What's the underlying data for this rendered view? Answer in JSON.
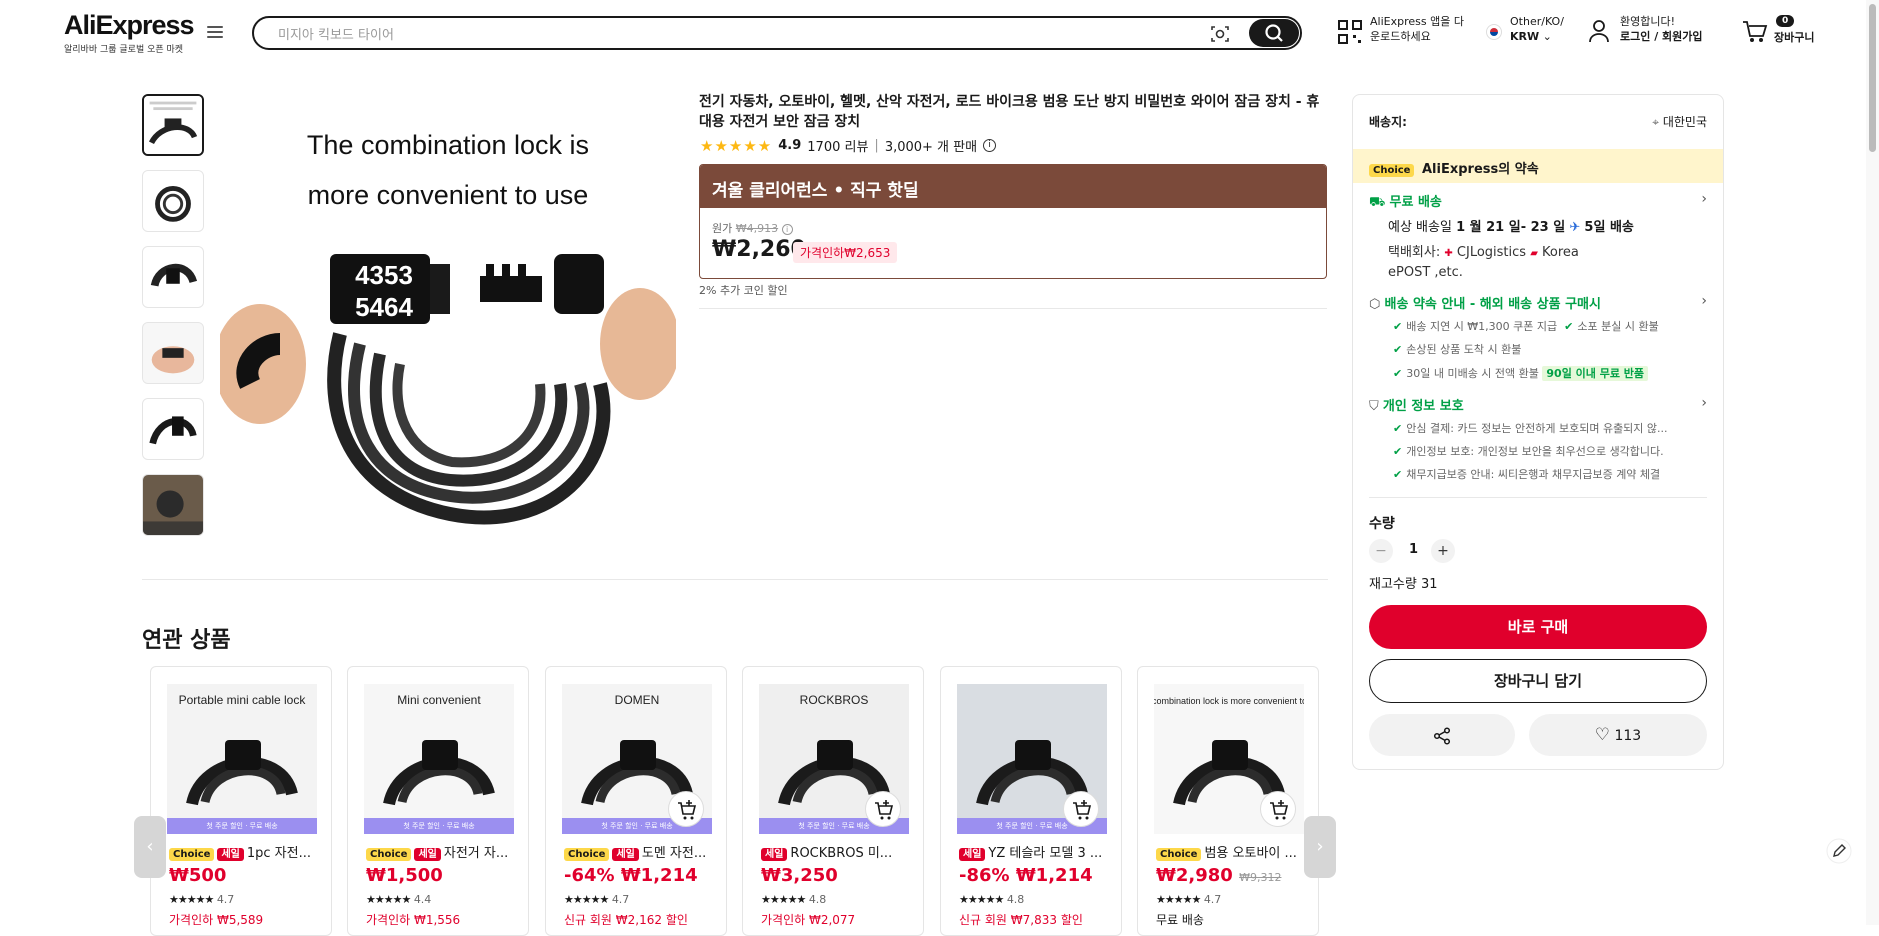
{
  "header": {
    "brand": "AliExpress",
    "brand_sub": "알리바바 그룹 글로벌 오픈 마켓",
    "search_placeholder": "미지아 킥보드 타이어",
    "app_line1": "AliExpress 앱을 다",
    "app_line2": "운로드하세요",
    "locale_line1": "Other/KO/",
    "locale_line2": "KRW",
    "account_line1": "환영합니다!",
    "account_line2": "로그인 / 회원가입",
    "cart_count": "0",
    "cart_label": "장바구니"
  },
  "gallery": {
    "caption_line1": "The combination lock is",
    "caption_line2": "more convenient to use",
    "code_top": "4353",
    "code_bottom": "5464"
  },
  "product": {
    "title": "전기 자동차, 오토바이, 헬멧, 산악 자전거, 로드 바이크용 범용 도난 방지 비밀번호 와이어 잠금 장치 - 휴대용 자전거 보안 잠금 장치",
    "rating": "4.9",
    "reviews": "1700 리뷰",
    "sold": "3,000+ 개 판매",
    "promo_banner": "겨울 클리어런스 • 직구 핫딜",
    "orig_label": "원가",
    "orig_price": "₩4,913",
    "price": "₩2,260",
    "discount": "가격인하₩2,653",
    "coin": "2% 추가 코인 할인"
  },
  "related": {
    "title": "연관 상품",
    "items": [
      {
        "img_text": "Portable mini cable lock",
        "tags": [
          "Choice",
          "세일"
        ],
        "name": "1pc 자전...",
        "price": "₩500",
        "old": "",
        "rating": "4.7",
        "extra": "가격인하 ₩5,589",
        "strip": "첫 주문 할인 · 무료 배송"
      },
      {
        "img_text": "Mini convenient",
        "tags": [
          "Choice",
          "세일"
        ],
        "name": "자전거 자...",
        "price": "₩1,500",
        "old": "",
        "rating": "4.4",
        "extra": "가격인하 ₩1,556",
        "strip": "첫 주문 할인 · 무료 배송"
      },
      {
        "img_text": "DOMEN",
        "tags": [
          "Choice",
          "세일"
        ],
        "name": "도멘 자전...",
        "price": "-64% ₩1,214",
        "old": "",
        "rating": "4.7",
        "extra": "신규 회원 ₩2,162 할인",
        "strip": "첫 주문 할인 · 무료 배송"
      },
      {
        "img_text": "ROCKBROS",
        "tags": [
          "세일"
        ],
        "name": "ROCKBROS 미...",
        "price": "₩3,250",
        "old": "",
        "rating": "4.8",
        "extra": "가격인하 ₩2,077",
        "strip": "첫 주문 할인 · 무료 배송"
      },
      {
        "img_text": "",
        "tags": [
          "세일"
        ],
        "name": "YZ 테슬라 모델 3 ...",
        "price": "-86% ₩1,214",
        "old": "",
        "rating": "4.8",
        "extra": "신규 회원 ₩7,833 할인",
        "strip": "첫 주문 할인 · 무료 배송"
      },
      {
        "img_text": "The combination lock is more convenient to use",
        "tags": [
          "Choice"
        ],
        "name": "범용 오토바이 ...",
        "price": "₩2,980",
        "old": "₩9,312",
        "rating": "4.7",
        "extra": "무료 배송",
        "strip": ""
      }
    ]
  },
  "side": {
    "ship_to": "배송지:",
    "country": "대한민국",
    "choice": "Choice",
    "promise": "AliExpress의 약속",
    "free_ship": "무료 배송",
    "eta_prefix": "예상 배송일",
    "eta_dates": "1 월 21 일- 23 일",
    "eta_days": "5일 배송",
    "carrier_label": "택배회사:",
    "carrier1": "CJLogistics",
    "carrier2": "Korea",
    "carrier3": "ePOST ,etc.",
    "promise_title": "배송 약속 안내 - 해외 배송 상품 구매시",
    "p1": "배송 지연 시 ₩1,300 쿠폰 지급",
    "p2": "소포 분실 시 환불",
    "p3": "손상된 상품 도착 시 환불",
    "p4": "30일 내 미배송 시 전액 환불",
    "p4_badge": "90일 이내 무료 반품",
    "privacy_title": "개인 정보 보호",
    "s1": "안심 결제: 카드 정보는 안전하게 보호되며 유출되지 않...",
    "s2": "개인정보 보호: 개인정보 보안을 최우선으로 생각합니다.",
    "s3": "채무지급보증 안내: 씨티은행과 채무지급보증 계약 체결",
    "qty_label": "수량",
    "qty": "1",
    "stock": "재고수량 31",
    "buy_now": "바로 구매",
    "add_cart": "장바구니 담기",
    "wish_count": "113"
  },
  "colors": {
    "accent_red": "#e0002c",
    "promo_brown": "#7b4a3a",
    "choice_yellow": "#fdd84a",
    "green": "#00a046",
    "star": "#fdb813"
  }
}
